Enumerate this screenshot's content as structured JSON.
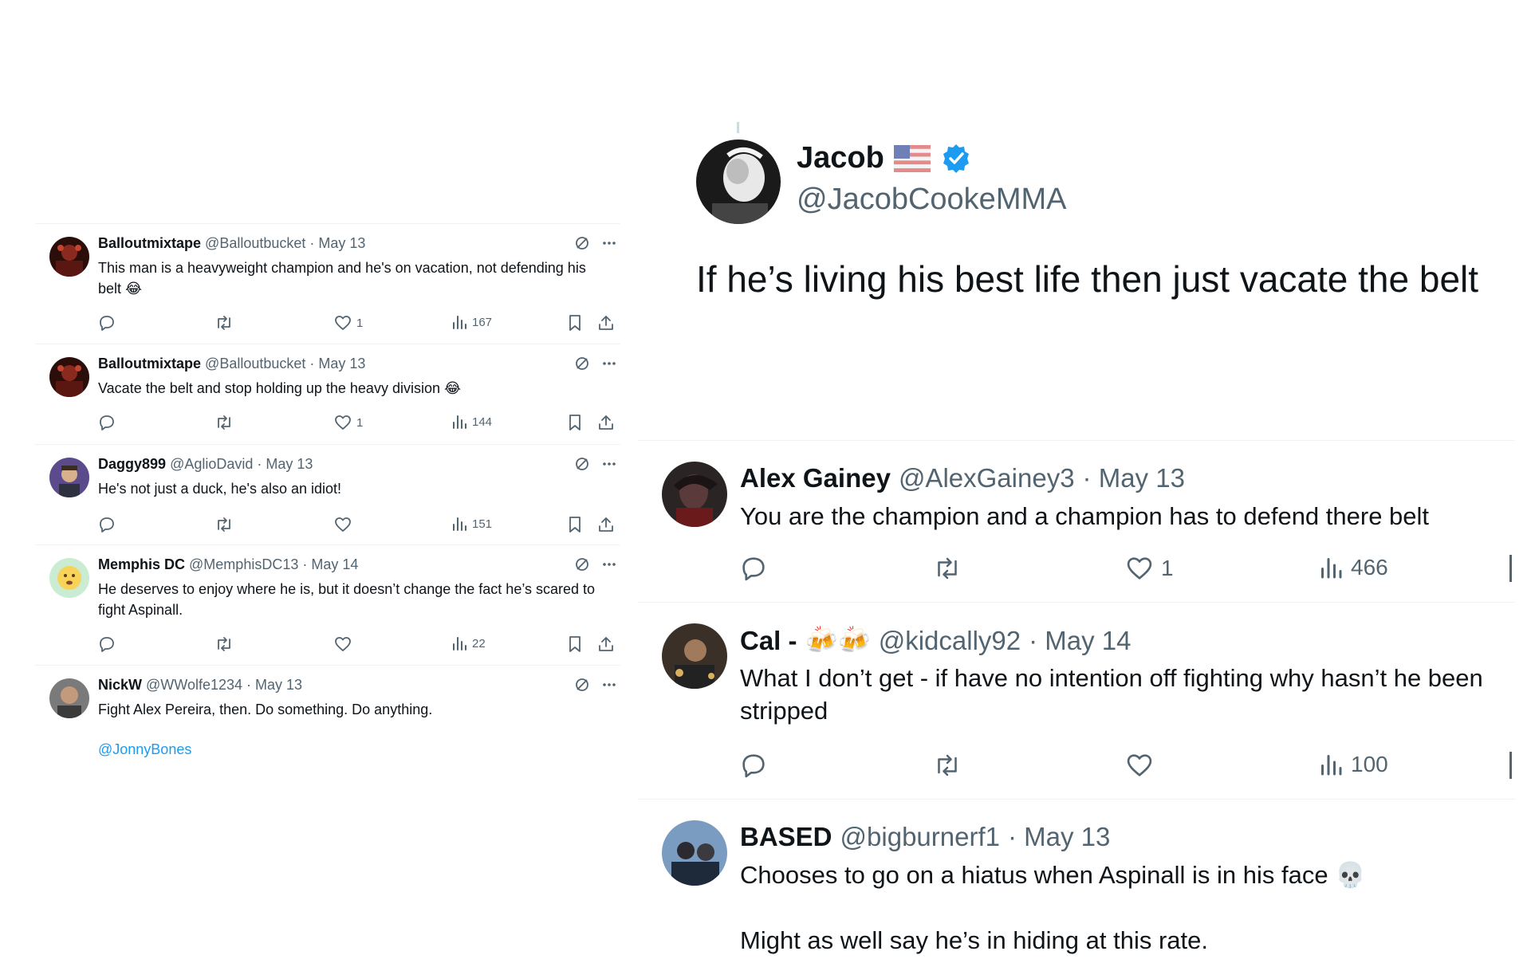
{
  "left_tweets": [
    {
      "name": "Balloutmixtape",
      "handle": "@Balloutbucket",
      "date": "· May 13",
      "text": "This man is a heavyweight champion and he's on vacation, not defending his belt 😂",
      "likes": "1",
      "views": "167",
      "avatar_color": "#3a1410"
    },
    {
      "name": "Balloutmixtape",
      "handle": "@Balloutbucket",
      "date": "· May 13",
      "text": "Vacate the belt and stop holding up the heavy division 😂",
      "likes": "1",
      "views": "144",
      "avatar_color": "#3a1410"
    },
    {
      "name": "Daggy899",
      "handle": "@AglioDavid",
      "date": "· May 13",
      "text": "He's not just a duck, he's also an idiot!",
      "likes": "",
      "views": "151",
      "avatar_color": "#5b4a8c"
    },
    {
      "name": "Memphis DC",
      "handle": "@MemphisDC13",
      "date": "· May 14",
      "text": "He deserves to enjoy where he is, but it doesn’t change the fact he’s scared to fight Aspinall.",
      "likes": "",
      "views": "22",
      "avatar_color": "#bfe6c8"
    },
    {
      "name": "NickW",
      "handle": "@WWolfe1234",
      "date": "· May 13",
      "text": "Fight Alex Pereira, then. Do something. Do anything.",
      "link": "@JonnyBones",
      "avatar_color": "#6b6b6b"
    }
  ],
  "main_tweet": {
    "name": "Jacob",
    "handle": "@JacobCookeMMA",
    "text": "If he’s living his best life then just vacate the belt",
    "avatar_color": "#222222"
  },
  "right_replies": [
    {
      "name": "Alex Gainey",
      "handle": "@AlexGainey3",
      "date": "· May 13",
      "text": "You are the champion and a champion has to defend there belt",
      "likes": "1",
      "views": "466",
      "avatar_color": "#3a2a2a"
    },
    {
      "name": "Cal -",
      "emoji": "🍻🍻",
      "handle": "@kidcally92",
      "date": "· May 14",
      "text": "What I don’t get - if have no intention off fighting why hasn’t he been stripped",
      "likes": "",
      "views": "100",
      "avatar_color": "#4a3c30"
    },
    {
      "name": "BASED",
      "handle": "@bigburnerf1",
      "date": "· May 13",
      "text": "Chooses to go on a hiatus when Aspinall is in his face 💀",
      "text2": "Might as well say he’s in hiding at this rate.",
      "avatar_color": "#5a7aa0"
    }
  ],
  "colors": {
    "muted": "#536471",
    "text": "#0f1419",
    "link": "#1d9bf0",
    "verified": "#1d9bf0",
    "divider": "#eff3f4"
  }
}
